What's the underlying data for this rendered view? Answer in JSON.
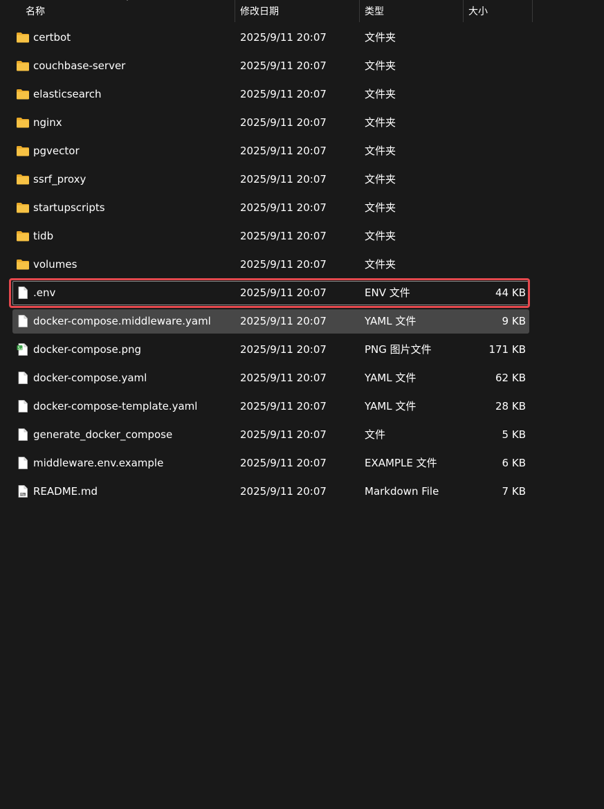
{
  "columns": {
    "name": "名称",
    "date": "修改日期",
    "type": "类型",
    "size": "大小"
  },
  "colors": {
    "background": "#191919",
    "hover_row": "#474747",
    "highlight_outline": "#e5484d",
    "folder": "#f7c244"
  },
  "files": [
    {
      "name": "certbot",
      "date": "2025/9/11 20:07",
      "type": "文件夹",
      "size": "",
      "icon": "folder-icon"
    },
    {
      "name": "couchbase-server",
      "date": "2025/9/11 20:07",
      "type": "文件夹",
      "size": "",
      "icon": "folder-icon"
    },
    {
      "name": "elasticsearch",
      "date": "2025/9/11 20:07",
      "type": "文件夹",
      "size": "",
      "icon": "folder-icon"
    },
    {
      "name": "nginx",
      "date": "2025/9/11 20:07",
      "type": "文件夹",
      "size": "",
      "icon": "folder-icon"
    },
    {
      "name": "pgvector",
      "date": "2025/9/11 20:07",
      "type": "文件夹",
      "size": "",
      "icon": "folder-icon"
    },
    {
      "name": "ssrf_proxy",
      "date": "2025/9/11 20:07",
      "type": "文件夹",
      "size": "",
      "icon": "folder-icon"
    },
    {
      "name": "startupscripts",
      "date": "2025/9/11 20:07",
      "type": "文件夹",
      "size": "",
      "icon": "folder-icon"
    },
    {
      "name": "tidb",
      "date": "2025/9/11 20:07",
      "type": "文件夹",
      "size": "",
      "icon": "folder-icon"
    },
    {
      "name": "volumes",
      "date": "2025/9/11 20:07",
      "type": "文件夹",
      "size": "",
      "icon": "folder-icon"
    },
    {
      "name": ".env",
      "date": "2025/9/11 20:07",
      "type": "ENV 文件",
      "size": "44 KB",
      "icon": "file-icon"
    },
    {
      "name": "docker-compose.middleware.yaml",
      "date": "2025/9/11 20:07",
      "type": "YAML 文件",
      "size": "9 KB",
      "icon": "file-icon"
    },
    {
      "name": "docker-compose.png",
      "date": "2025/9/11 20:07",
      "type": "PNG 图片文件",
      "size": "171 KB",
      "icon": "image-file-icon"
    },
    {
      "name": "docker-compose.yaml",
      "date": "2025/9/11 20:07",
      "type": "YAML 文件",
      "size": "62 KB",
      "icon": "file-icon"
    },
    {
      "name": "docker-compose-template.yaml",
      "date": "2025/9/11 20:07",
      "type": "YAML 文件",
      "size": "28 KB",
      "icon": "file-icon"
    },
    {
      "name": "generate_docker_compose",
      "date": "2025/9/11 20:07",
      "type": "文件",
      "size": "5 KB",
      "icon": "file-icon"
    },
    {
      "name": "middleware.env.example",
      "date": "2025/9/11 20:07",
      "type": "EXAMPLE 文件",
      "size": "6 KB",
      "icon": "file-icon"
    },
    {
      "name": "README.md",
      "date": "2025/9/11 20:07",
      "type": "Markdown File",
      "size": "7 KB",
      "icon": "markdown-file-icon"
    }
  ]
}
